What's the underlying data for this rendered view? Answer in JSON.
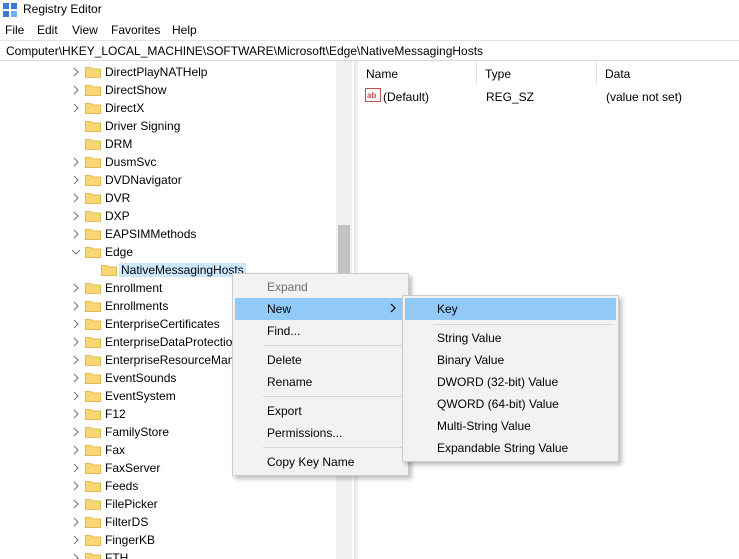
{
  "window": {
    "title": "Registry Editor",
    "icon": "registry-editor-icon"
  },
  "menubar": [
    "File",
    "Edit",
    "View",
    "Favorites",
    "Help"
  ],
  "address": "Computer\\HKEY_LOCAL_MACHINE\\SOFTWARE\\Microsoft\\Edge\\NativeMessagingHosts",
  "tree": {
    "items": [
      {
        "label": "DirectPlayNATHelp",
        "state": "collapsed"
      },
      {
        "label": "DirectShow",
        "state": "collapsed"
      },
      {
        "label": "DirectX",
        "state": "collapsed"
      },
      {
        "label": "Driver Signing",
        "state": "none"
      },
      {
        "label": "DRM",
        "state": "none"
      },
      {
        "label": "DusmSvc",
        "state": "collapsed"
      },
      {
        "label": "DVDNavigator",
        "state": "collapsed"
      },
      {
        "label": "DVR",
        "state": "collapsed"
      },
      {
        "label": "DXP",
        "state": "collapsed"
      },
      {
        "label": "EAPSIMMethods",
        "state": "collapsed"
      },
      {
        "label": "Edge",
        "state": "expanded"
      },
      {
        "label": "NativeMessagingHosts",
        "state": "none",
        "child": true,
        "selected": true
      },
      {
        "label": "Enrollment",
        "state": "collapsed"
      },
      {
        "label": "Enrollments",
        "state": "collapsed"
      },
      {
        "label": "EnterpriseCertificates",
        "state": "collapsed"
      },
      {
        "label": "EnterpriseDataProtection",
        "state": "collapsed"
      },
      {
        "label": "EnterpriseResourceManager",
        "state": "collapsed"
      },
      {
        "label": "EventSounds",
        "state": "collapsed"
      },
      {
        "label": "EventSystem",
        "state": "collapsed"
      },
      {
        "label": "F12",
        "state": "collapsed"
      },
      {
        "label": "FamilyStore",
        "state": "collapsed"
      },
      {
        "label": "Fax",
        "state": "collapsed"
      },
      {
        "label": "FaxServer",
        "state": "collapsed"
      },
      {
        "label": "Feeds",
        "state": "collapsed"
      },
      {
        "label": "FilePicker",
        "state": "collapsed"
      },
      {
        "label": "FilterDS",
        "state": "collapsed"
      },
      {
        "label": "FingerKB",
        "state": "collapsed"
      },
      {
        "label": "FTH",
        "state": "collapsed"
      }
    ]
  },
  "values": {
    "columns": [
      "Name",
      "Type",
      "Data"
    ],
    "rows": [
      {
        "name": "(Default)",
        "type": "REG_SZ",
        "data": "(value not set)",
        "icon": "string-value-icon"
      }
    ]
  },
  "context_menu": {
    "items": [
      "Expand",
      "New",
      "Find...",
      "Delete",
      "Rename",
      "Export",
      "Permissions...",
      "Copy Key Name"
    ],
    "disabled": [
      "Expand"
    ],
    "highlighted": "New"
  },
  "new_submenu": {
    "items": [
      "Key",
      "String Value",
      "Binary Value",
      "DWORD (32-bit) Value",
      "QWORD (64-bit) Value",
      "Multi-String Value",
      "Expandable String Value"
    ],
    "highlighted": "Key"
  },
  "colors": {
    "highlight": "#91c9f7",
    "selection": "#cce8ff",
    "folder": "#f8d775",
    "menu_bg": "#f2f2f2"
  }
}
